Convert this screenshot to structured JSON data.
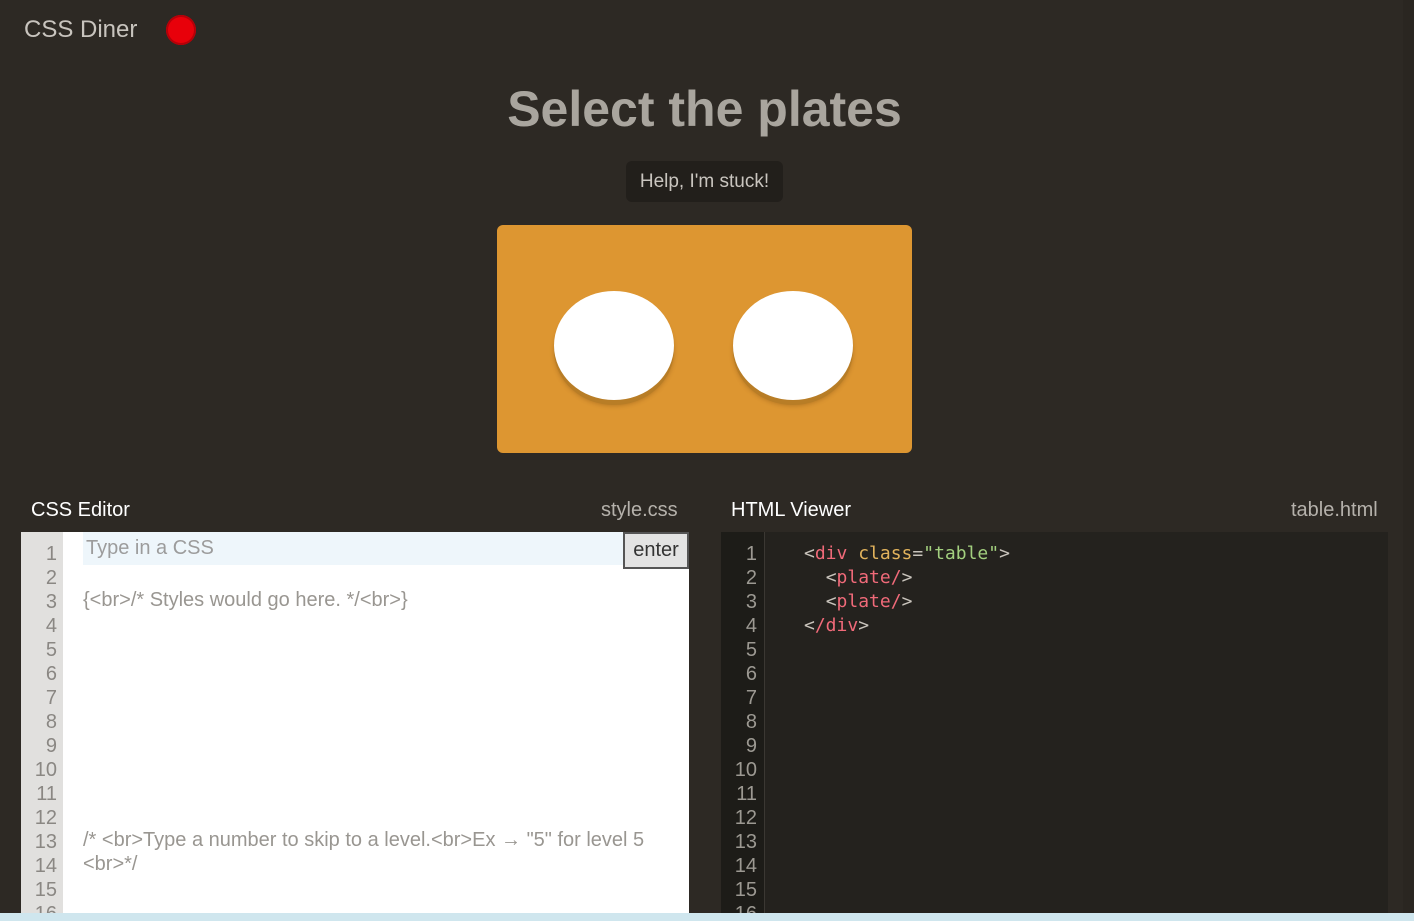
{
  "app": {
    "title": "CSS Diner"
  },
  "level": {
    "indicator_color": "#e8000a"
  },
  "instruction": "Select the plates",
  "help_button": "Help, I'm stuck!",
  "table": {
    "plates_count": 2
  },
  "css_editor": {
    "title": "CSS Editor",
    "file_name": "style.css",
    "placeholder": "Type in a CSS",
    "enter_label": "enter",
    "line_numbers": [
      "1",
      "2",
      "3",
      "4",
      "5",
      "6",
      "7",
      "8",
      "9",
      "10",
      "11",
      "12",
      "13",
      "14",
      "15",
      "16"
    ],
    "styles_text": "{<br>/* Styles would go here. */<br>}",
    "help_line_1": "/* <br>Type a number to skip to a level.<br>Ex → \"5\" for level 5",
    "help_line_2": "<br>*/"
  },
  "html_viewer": {
    "title": "HTML Viewer",
    "file_name": "table.html",
    "line_numbers": [
      "1",
      "2",
      "3",
      "4",
      "5",
      "6",
      "7",
      "8",
      "9",
      "10",
      "11",
      "12",
      "13",
      "14",
      "15",
      "16"
    ],
    "code": {
      "open_lt": "<",
      "open_tag": "div",
      "attr_name": "class",
      "eq": "=",
      "attr_value": "\"table\"",
      "open_gt": ">",
      "plate_1": "plate/",
      "plate_2": "plate/",
      "close_tag": "/div"
    }
  },
  "colors": {
    "background": "#2d2924",
    "table": "#dd9631",
    "plate": "#ffffff",
    "tag": "#f06a79",
    "attribute": "#e2b35c",
    "value": "#a3d07f"
  }
}
